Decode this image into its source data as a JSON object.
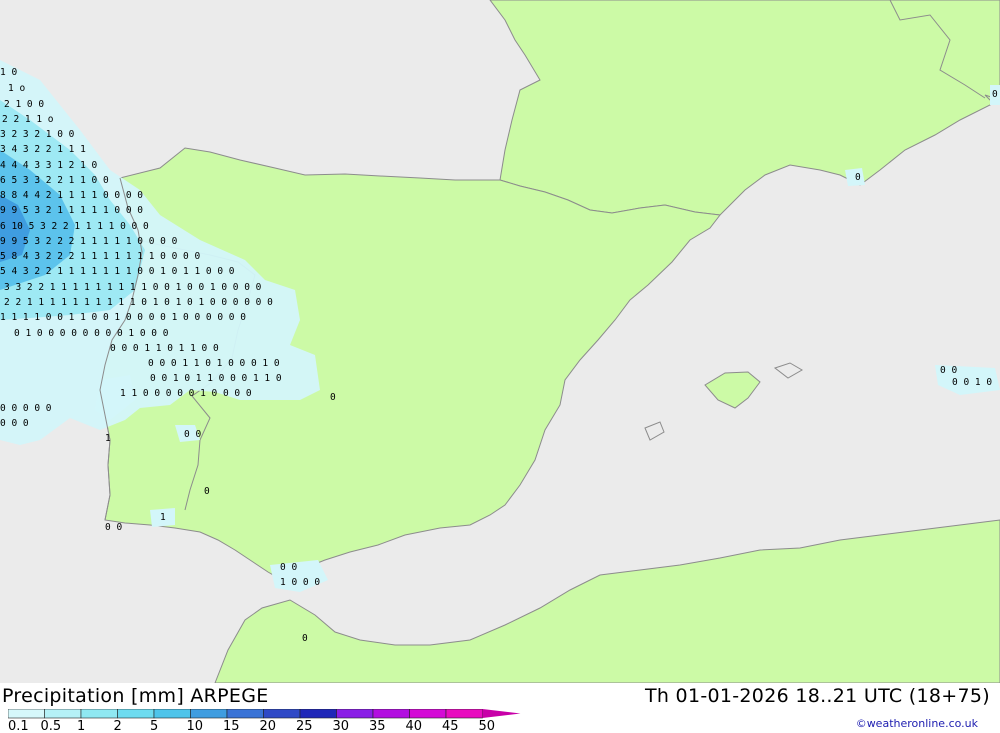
{
  "footer": {
    "title": "Precipitation [mm] ARPEGE",
    "validity": "Th 01-01-2026 18..21 UTC (18+75)",
    "credit": "©weatheronline.co.uk"
  },
  "legend": {
    "labels": [
      "0.1",
      "0.5",
      "1",
      "2",
      "5",
      "10",
      "15",
      "20",
      "25",
      "30",
      "35",
      "40",
      "45",
      "50"
    ],
    "colors": [
      "#d6f8fb",
      "#b5f1f7",
      "#8fe8f2",
      "#6ddbef",
      "#4ec4ea",
      "#3f9de0",
      "#3a73d6",
      "#2f49c6",
      "#1f27b8",
      "#8a1ee6",
      "#b20ee0",
      "#d40ad6",
      "#e80cbf",
      "#c800a8"
    ]
  },
  "map": {
    "region": "Iberian Peninsula",
    "colors": {
      "sea": "#ebebeb",
      "land": "#ccfaa6",
      "border": "#8c8c8c",
      "precip_light": "#d3f6fa",
      "precip_mid": "#9ee9f4",
      "precip_heavy": "#5cc3ec"
    }
  }
}
